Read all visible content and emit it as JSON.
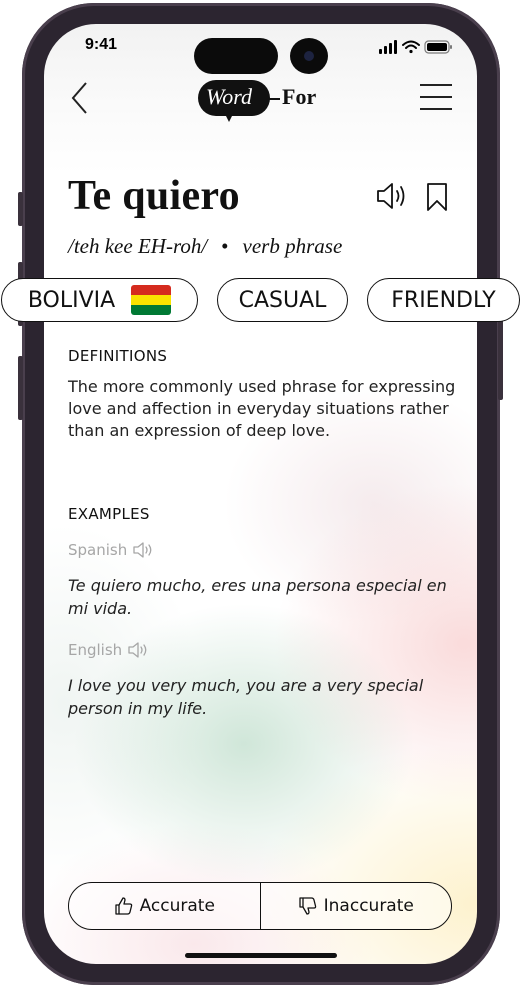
{
  "status_bar": {
    "time": "9:41"
  },
  "header": {
    "logo_word": "Word",
    "logo_for": "For"
  },
  "entry": {
    "title": "Te quiero",
    "pronunciation": "/teh kee EH-roh/",
    "separator": "•",
    "part_of_speech": "verb phrase"
  },
  "tags": [
    {
      "label": "BOLIVIA",
      "flag": "bolivia-flag",
      "flag_colors": [
        "#D52B1E",
        "#F9E300",
        "#007934"
      ]
    },
    {
      "label": "CASUAL"
    },
    {
      "label": "FRIENDLY"
    }
  ],
  "definitions": {
    "heading": "DEFINITIONS",
    "text": "The more commonly used phrase for expressing love and affection in everyday situations rather than an expression of deep love."
  },
  "examples": {
    "heading": "EXAMPLES",
    "items": [
      {
        "language": "Spanish",
        "sentence": "Te quiero mucho, eres una persona especial en mi vida."
      },
      {
        "language": "English",
        "sentence": "I love you very much, you are a very special person in my life."
      }
    ]
  },
  "feedback": {
    "accurate_label": "Accurate",
    "inaccurate_label": "Inaccurate"
  }
}
